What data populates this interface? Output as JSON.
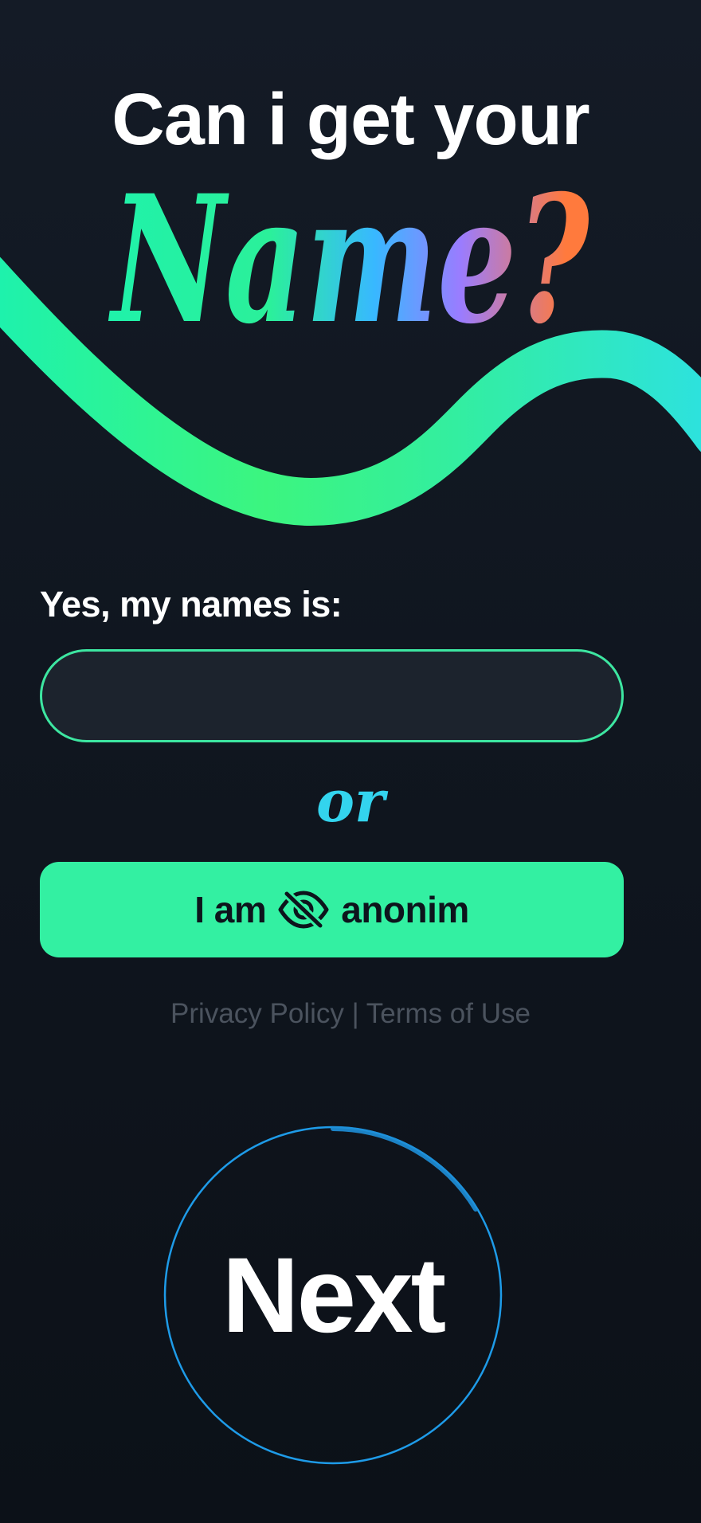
{
  "header": {
    "line1": "Can i get your",
    "line2": "Name?"
  },
  "form": {
    "label": "Yes, my names is:",
    "name_value": "",
    "name_placeholder": ""
  },
  "divider": {
    "or_text": "or"
  },
  "anonymous_button": {
    "prefix": "I am",
    "icon": "eye-off-icon",
    "suffix": "anonim"
  },
  "legal": {
    "privacy": "Privacy Policy",
    "separator": "|",
    "terms": "Terms of Use"
  },
  "next_button": {
    "label": "Next"
  },
  "colors": {
    "background": "#10161f",
    "accent_green": "#33f0a2",
    "input_border": "#3de6a1",
    "or_text": "#33d4ee",
    "next_ring": "#1e9be8",
    "title_gradient": [
      "#1ef2ac",
      "#38b8ff",
      "#9a7cff",
      "#ff7a3d"
    ],
    "wave_gradient": [
      "#1ef2ac",
      "#3cf57f",
      "#2de2dd"
    ],
    "legal_text": "#4b535e"
  }
}
